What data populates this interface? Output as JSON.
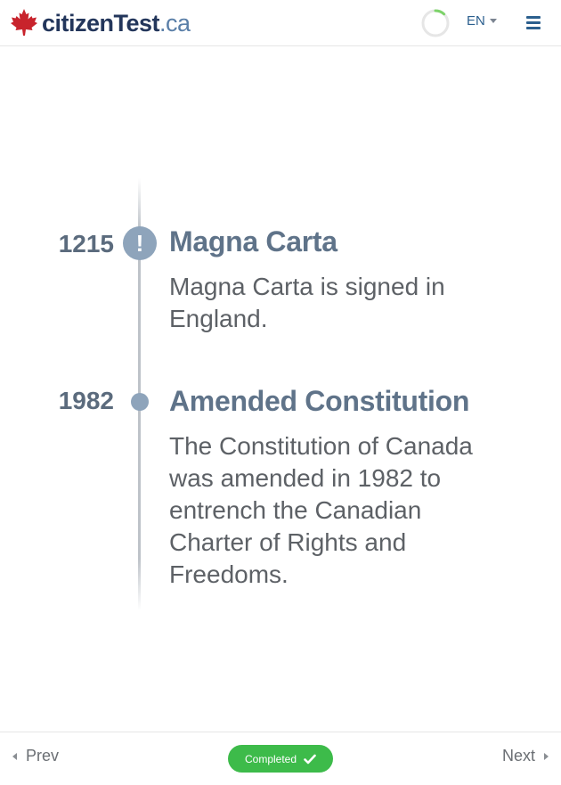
{
  "header": {
    "logo_brand": "citizenTest",
    "logo_tld": ".ca",
    "language": "EN",
    "progress": 0.12,
    "icons": {
      "logo": "maple-leaf-icon",
      "progress": "progress-ring-icon",
      "language_caret": "caret-down-icon",
      "menu": "hamburger-menu-icon"
    }
  },
  "timeline": {
    "events": [
      {
        "year": "1215",
        "title": "Magna Carta",
        "description": "Magna Carta is signed in England.",
        "marker_icon": "exclamation-icon",
        "marker_glyph": "!"
      },
      {
        "year": "1982",
        "title": "Amended Constitution",
        "description": "The Constitution of Canada was amended in 1982 to entrench the Canadian Charter of Rights and Freedoms.",
        "marker_icon": "dot-icon"
      }
    ]
  },
  "footer": {
    "prev_label": "Prev",
    "next_label": "Next",
    "status_label": "Completed"
  },
  "colors": {
    "brand_dark": "#23365b",
    "brand_light": "#5a7fa8",
    "maple_red": "#c8232c",
    "marker": "#8ea4bb",
    "completed_green": "#3dbb4a",
    "progress_green": "#7dd36a"
  }
}
